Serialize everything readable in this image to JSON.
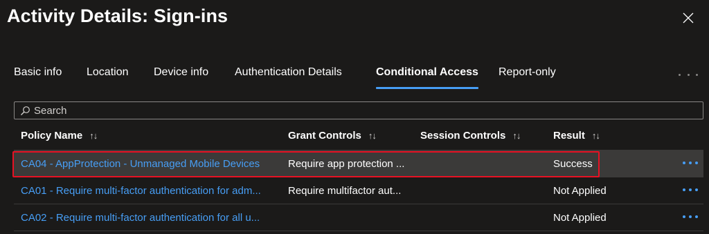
{
  "window": {
    "title": "Activity Details: Sign-ins"
  },
  "tabs": [
    {
      "label": "Basic info",
      "active": false
    },
    {
      "label": "Location",
      "active": false
    },
    {
      "label": "Device info",
      "active": false
    },
    {
      "label": "Authentication Details",
      "active": false
    },
    {
      "label": "Conditional Access",
      "active": true
    },
    {
      "label": "Report-only",
      "active": false
    }
  ],
  "search": {
    "placeholder": "Search",
    "value": ""
  },
  "table": {
    "columns": [
      "Policy Name",
      "Grant Controls",
      "Session Controls",
      "Result"
    ],
    "sort_icon": "↑↓",
    "rows": [
      {
        "policy": "CA04 - AppProtection - Unmanaged Mobile Devices",
        "grant": "Require app protection ...",
        "session": "",
        "result": "Success",
        "selected": true
      },
      {
        "policy": "CA01 - Require multi-factor authentication for adm...",
        "grant": "Require multifactor aut...",
        "session": "",
        "result": "Not Applied",
        "selected": false
      },
      {
        "policy": "CA02 - Require multi-factor authentication for all u...",
        "grant": "",
        "session": "",
        "result": "Not Applied",
        "selected": false
      }
    ]
  },
  "icons": {
    "close": "close-icon",
    "search": "search-icon",
    "more": "more-horizontal-icon",
    "sort": "sort-arrows-icon"
  },
  "colors": {
    "background": "#1b1a19",
    "accent": "#479ef5",
    "highlight": "#e81123",
    "selected_row": "#3b3a39"
  }
}
